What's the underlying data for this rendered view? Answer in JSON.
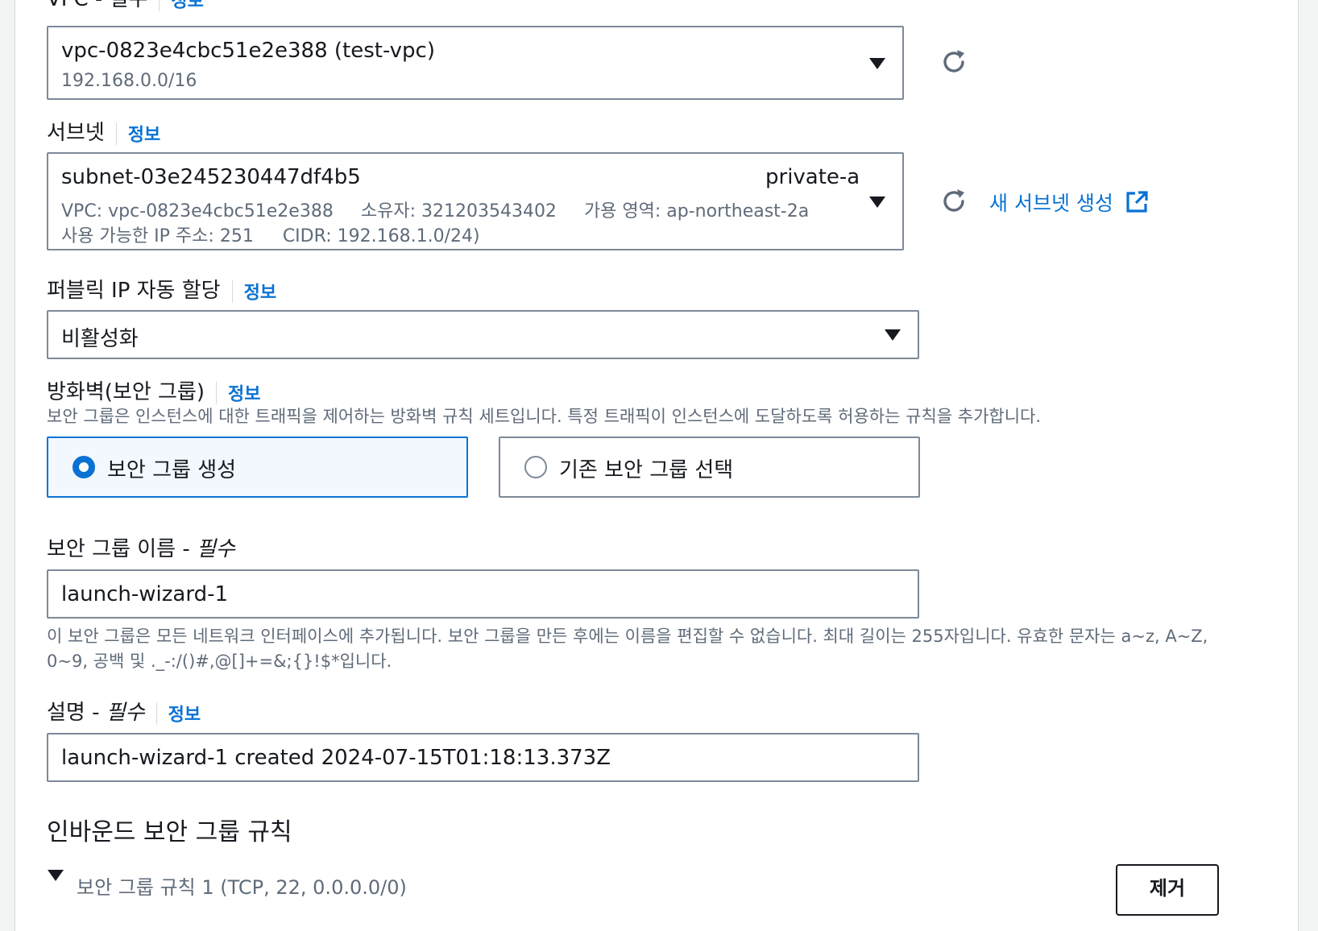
{
  "vpc": {
    "label": "VPC - 필수",
    "info": "정보",
    "value": "vpc-0823e4cbc51e2e388 (test-vpc)",
    "cidr": "192.168.0.0/16"
  },
  "subnet": {
    "label": "서브넷",
    "info": "정보",
    "id": "subnet-03e245230447df4b5",
    "name": "private-a",
    "vpc": "VPC: vpc-0823e4cbc51e2e388",
    "owner": "소유자: 321203543402",
    "az": "가용 영역: ap-northeast-2a",
    "available_ips": "사용 가능한 IP 주소: 251",
    "cidr": "CIDR: 192.168.1.0/24)",
    "create_link": "새 서브넷 생성"
  },
  "public_ip": {
    "label": "퍼블릭 IP 자동 할당",
    "info": "정보",
    "value": "비활성화"
  },
  "firewall": {
    "label": "방화벽(보안 그룹)",
    "info": "정보",
    "description": "보안 그룹은 인스턴스에 대한 트래픽을 제어하는 방화벽 규칙 세트입니다. 특정 트래픽이 인스턴스에 도달하도록 허용하는 규칙을 추가합니다.",
    "options": [
      {
        "label": "보안 그룹 생성",
        "selected": true
      },
      {
        "label": "기존 보안 그룹 선택",
        "selected": false
      }
    ]
  },
  "sg_name": {
    "label": "보안 그룹 이름 - ",
    "required": "필수",
    "value": "launch-wizard-1",
    "help_line1": "이 보안 그룹은 모든 네트워크 인터페이스에 추가됩니다. 보안 그룹을 만든 후에는 이름을 편집할 수 없습니다. 최대 길이는 255자입니다. 유효한 문자는 a~z, A~Z,",
    "help_line2": "0~9, 공백 및 ._-:/()#,@[]+=&;{}!$*입니다."
  },
  "description": {
    "label": "설명 - ",
    "required": "필수",
    "info": "정보",
    "value": "launch-wizard-1 created 2024-07-15T01:18:13.373Z"
  },
  "inbound": {
    "heading": "인바운드 보안 그룹 규칙",
    "rule_title": "보안 그룹 규칙 1 (TCP, 22, 0.0.0.0/0)",
    "remove_button": "제거"
  },
  "colors": {
    "link": "#0972d3",
    "border": "#7d8998",
    "selected_bg": "#f2f8fd"
  },
  "icons": [
    "caret-down-icon",
    "refresh-icon",
    "external-link-icon",
    "radio-icon"
  ]
}
